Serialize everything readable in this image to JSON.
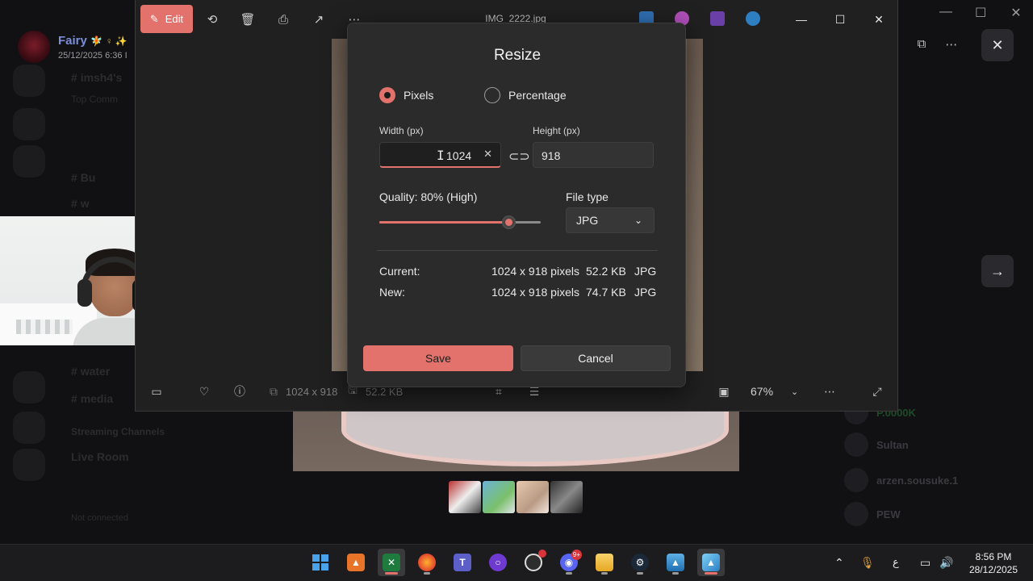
{
  "background": {
    "post_user": "Fairy",
    "post_user_emoji": "🧚 ♀ ✨",
    "post_date": "25/12/2025 6:36 I",
    "channels": [
      "imsh4's",
      "Top Comm",
      "Bu",
      "w",
      "water",
      "media"
    ],
    "section_label": "Streaming Channels",
    "channel_bottom": "Live Room",
    "members": [
      "P.0000K",
      "Sultan",
      "arzen.sousuke.1",
      "PEW"
    ],
    "user_panel_status": "Not connected"
  },
  "photos": {
    "edit_label": "Edit",
    "title": "IMG_2222.jpg",
    "dimensions": "1024 x 918",
    "file_size": "52.2 KB",
    "zoom": "67%"
  },
  "dialog": {
    "title": "Resize",
    "radio_pixels": "Pixels",
    "radio_percentage": "Percentage",
    "width_label": "Width  (px)",
    "width_value": "1024",
    "height_label": "Height  (px)",
    "height_value": "918",
    "quality_label": "Quality: 80% (High)",
    "quality_value": 0.8,
    "file_type_label": "File type",
    "file_type_value": "JPG",
    "current_label": "Current:",
    "current_dims": "1024 x 918 pixels",
    "current_size": "52.2 KB",
    "current_type": "JPG",
    "new_label": "New:",
    "new_dims": "1024 x 918 pixels",
    "new_size": "74.7 KB",
    "new_type": "JPG",
    "save_label": "Save",
    "cancel_label": "Cancel"
  },
  "taskbar": {
    "discord_badge": "9+",
    "time": "8:56 PM",
    "date": "28/12/2025",
    "lang_indicator": "ع"
  },
  "colors": {
    "accent": "#e2726b",
    "dialog_bg": "#2b2b2b",
    "window_bg": "#202020"
  }
}
